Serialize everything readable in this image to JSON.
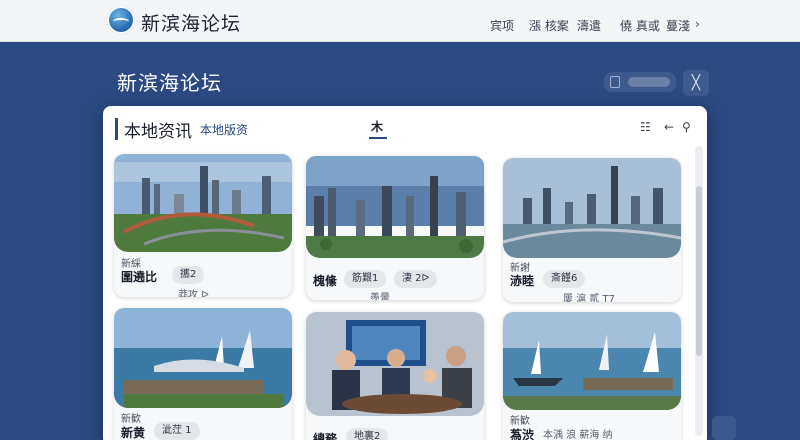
{
  "header": {
    "site_name": "新滨海论坛",
    "nav": [
      "宾项",
      "漲 核案",
      "濤遣",
      "僥 真或",
      "蔓淺"
    ],
    "nav_more": "›"
  },
  "banner": {
    "title": "新滨海论坛",
    "close_label": "╳"
  },
  "panel": {
    "title": "本地资讯",
    "subtitle": "本地版资",
    "center_tab": "木",
    "tools": [
      "☷",
      "←",
      "⚲"
    ]
  },
  "cards": [
    {
      "tag": "新綵",
      "name": "圍遶比",
      "chip": "攜2",
      "meta": "莽攻 ᐅ",
      "scene": "city-bridge"
    },
    {
      "tag": "",
      "name": "槐絛",
      "chip": "筋艱1",
      "chip2": "淒 2ᐅ",
      "meta": "羨暈",
      "scene": "city-skyline"
    },
    {
      "tag": "新謝",
      "name": "浾睦",
      "chip": "斎饉6",
      "meta": "屢 滬 貳 Т7",
      "scene": "city-harbor"
    },
    {
      "tag": "新歓",
      "name": "新黄",
      "chip": "泚茳 1",
      "meta": "",
      "scene": "sea-sails"
    },
    {
      "tag": "",
      "name": "總務",
      "chip": "地裏2",
      "meta": "",
      "scene": "meeting"
    },
    {
      "tag": "新歓",
      "name": "蒍渋",
      "chip": "本渪 浪 薪海 纳",
      "meta": "",
      "scene": "sea-sails-2"
    }
  ]
}
